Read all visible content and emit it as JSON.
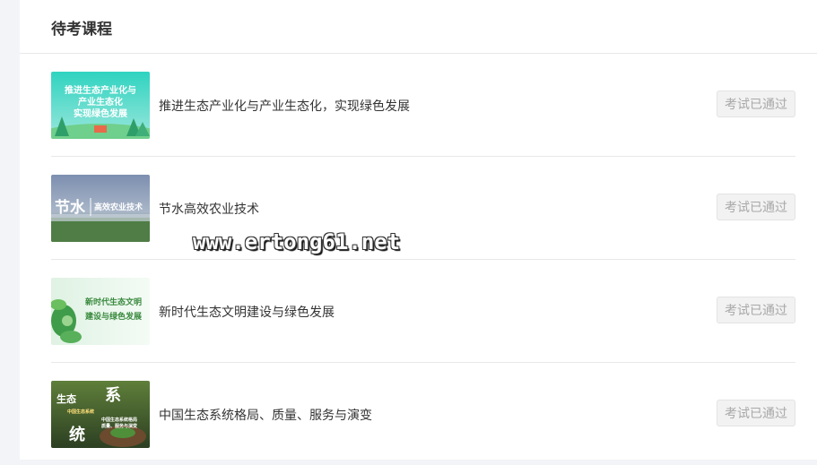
{
  "section": {
    "title": "待考课程"
  },
  "courses": [
    {
      "title": "推进生态产业化与产业生态化，实现绿色发展",
      "thumb_text": [
        "推进生态产业化与",
        "产业生态化",
        "实现绿色发展"
      ],
      "status": "考试已通过"
    },
    {
      "title": "节水高效农业技术",
      "thumb_text": [
        "节水",
        "高效农业技术"
      ],
      "status": "考试已通过"
    },
    {
      "title": "新时代生态文明建设与绿色发展",
      "thumb_text": [
        "新时代生态文明",
        "建设与绿色发展"
      ],
      "status": "考试已通过"
    },
    {
      "title": "中国生态系统格局、质量、服务与演变",
      "thumb_text": [
        "生态",
        "系",
        "统",
        "中国生态系统",
        "中国生态系统格局",
        "质量、服务与演变"
      ],
      "status": "考试已通过"
    }
  ],
  "watermark": "www.ertong61.net",
  "colors": {
    "accent_teal": "#3cc9b5",
    "page_bg": "#f3f4f7",
    "button_bg": "#f2f2f2",
    "button_text": "#a8a8a8"
  }
}
